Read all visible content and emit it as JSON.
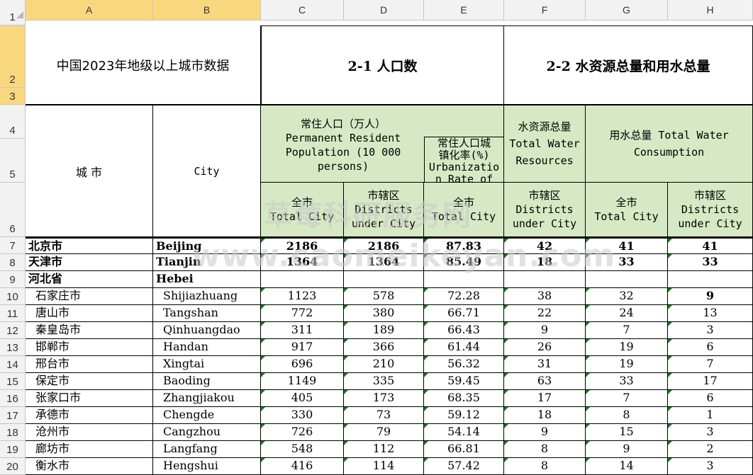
{
  "col_headers": [
    "A",
    "B",
    "C",
    "D",
    "E",
    "F",
    "G",
    "H"
  ],
  "row_numbers": [
    "1",
    "2",
    "3",
    "4",
    "5",
    "6",
    "7",
    "8",
    "9",
    "10",
    "11",
    "12",
    "13",
    "14",
    "15",
    "16",
    "17",
    "18",
    "19",
    "20"
  ],
  "title_cn": "中国2023年地级以上城市数据",
  "section_population": "2-1  人口数",
  "section_water": "2-2  水资源总量和用水总量",
  "hdr_city_cn": "城  市",
  "hdr_city_en": "City",
  "hdr_perm_pop": "常住人口（万人）\nPermanent Resident\nPopulation (10 000\npersons)",
  "hdr_urban_rate": "常住人口城\n镇化率(%)\nUrbanizatio\nn Rate of",
  "hdr_water_res": "水资源总量\nTotal Water\nResources",
  "hdr_water_cons": "用水总量 Total Water\nConsumption",
  "hdr_c6": "全市\nTotal City",
  "hdr_d6": "市辖区\nDistricts\nunder City",
  "hdr_e6": "全市\nTotal City",
  "hdr_f6": "市辖区\nDistricts\nunder City",
  "hdr_g6": "全市\nTotal City",
  "hdr_h6": "市辖区\nDistricts\nunder City",
  "watermark_cn": "草莓科研服务网",
  "watermark_url": "www.caomeikeyan.com",
  "rows": [
    {
      "cn": "北京市",
      "en": "Beijing",
      "c": "2186",
      "d": "2186",
      "e": "87.83",
      "f": "42",
      "g": "41",
      "h": "41"
    },
    {
      "cn": "天津市",
      "en": "Tianjin",
      "c": "1364",
      "d": "1364",
      "e": "85.49",
      "f": "18",
      "g": "33",
      "h": "33"
    },
    {
      "cn": "河北省",
      "en": "Hebei",
      "c": "",
      "d": "",
      "e": "",
      "f": "",
      "g": "",
      "h": ""
    },
    {
      "cn": "石家庄市",
      "en": "Shijiazhuang",
      "c": "1123",
      "d": "578",
      "e": "72.28",
      "f": "38",
      "g": "32",
      "h": "9"
    },
    {
      "cn": "唐山市",
      "en": "Tangshan",
      "c": "772",
      "d": "380",
      "e": "66.71",
      "f": "22",
      "g": "24",
      "h": "13"
    },
    {
      "cn": "秦皇岛市",
      "en": "Qinhuangdao",
      "c": "311",
      "d": "189",
      "e": "66.43",
      "f": "9",
      "g": "7",
      "h": "3"
    },
    {
      "cn": "邯郸市",
      "en": "Handan",
      "c": "917",
      "d": "366",
      "e": "61.44",
      "f": "26",
      "g": "19",
      "h": "6"
    },
    {
      "cn": "邢台市",
      "en": "Xingtai",
      "c": "696",
      "d": "210",
      "e": "56.32",
      "f": "31",
      "g": "19",
      "h": "7"
    },
    {
      "cn": "保定市",
      "en": "Baoding",
      "c": "1149",
      "d": "335",
      "e": "59.45",
      "f": "63",
      "g": "33",
      "h": "17"
    },
    {
      "cn": "张家口市",
      "en": "Zhangjiakou",
      "c": "405",
      "d": "173",
      "e": "68.35",
      "f": "17",
      "g": "7",
      "h": "6"
    },
    {
      "cn": "承德市",
      "en": "Chengde",
      "c": "330",
      "d": "73",
      "e": "59.12",
      "f": "18",
      "g": "8",
      "h": "1"
    },
    {
      "cn": "沧州市",
      "en": "Cangzhou",
      "c": "726",
      "d": "79",
      "e": "54.14",
      "f": "9",
      "g": "15",
      "h": "3"
    },
    {
      "cn": "廊坊市",
      "en": "Langfang",
      "c": "548",
      "d": "112",
      "e": "66.81",
      "f": "8",
      "g": "9",
      "h": "2"
    },
    {
      "cn": "衡水市",
      "en": "Hengshui",
      "c": "416",
      "d": "114",
      "e": "57.42",
      "f": "8",
      "g": "14",
      "h": "3"
    }
  ]
}
